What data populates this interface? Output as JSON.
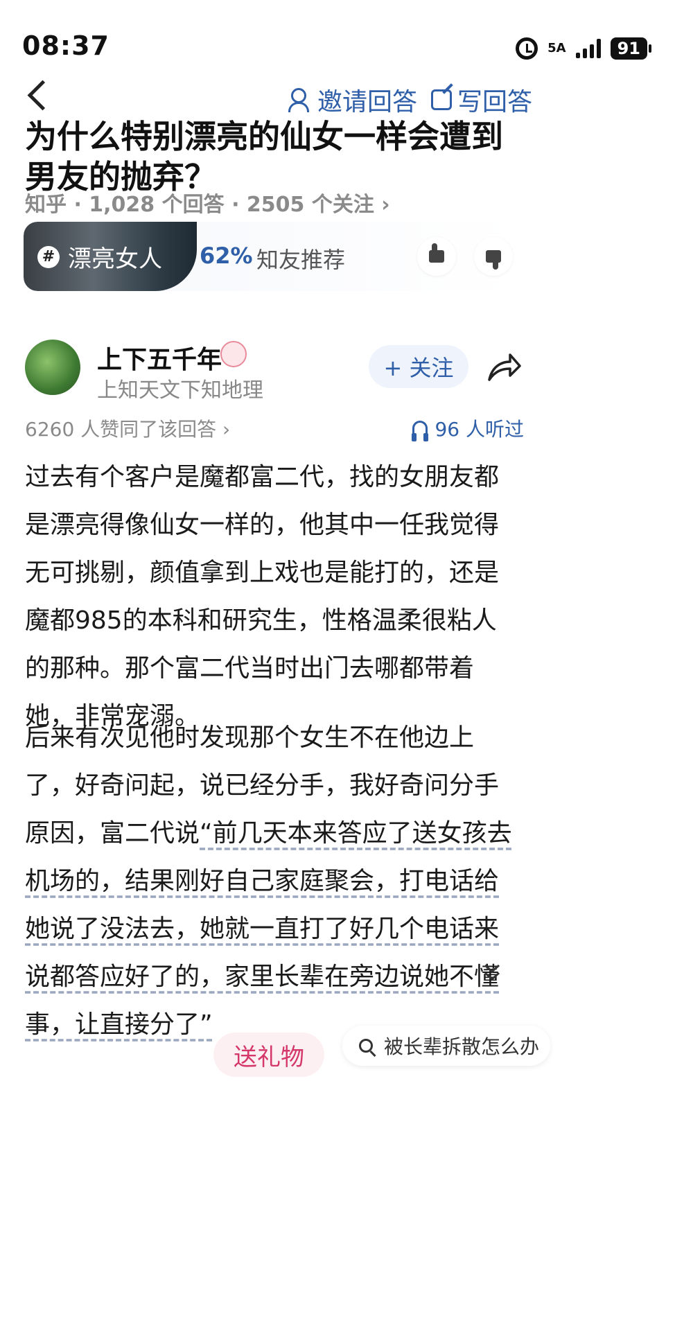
{
  "status_bar": {
    "time": "08:37",
    "network": "5A",
    "battery": "91",
    "icons": [
      "alarm-icon",
      "signal-icon",
      "battery-icon"
    ]
  },
  "header": {
    "invite_label": "邀请回答",
    "write_label": "写回答"
  },
  "question": {
    "title": "为什么特别漂亮的仙女一样会遭到男友的抛弃？",
    "meta": "知乎 · 1,028 个回答 · 2505 个关注 ›"
  },
  "topic": {
    "tag": "漂亮女人",
    "recommend_percent": "62%",
    "recommend_label": "知友推荐"
  },
  "author": {
    "name": "上下五千年",
    "bio": "上知天文下知地理",
    "follow_label": "+ 关注"
  },
  "stats": {
    "agree": "6260 人赞同了该回答 ›",
    "listened": "96 人听过"
  },
  "answer": {
    "para1": "过去有个客户是魔都富二代，找的女朋友都是漂亮得像仙女一样的，他其中一任我觉得无可挑剔，颜值拿到上戏也是能打的，还是魔都985的本科和研究生，性格温柔很粘人的那种。那个富二代当时出门去哪都带着她，非常宠溺。",
    "para2_plain": "后来有次见他时发现那个女生不在他边上了，好奇问起，说已经分手，我好奇问分手原因，富二代说",
    "para2_quote": "“前几天本来答应了送女孩去机场的，结果刚好自己家庭聚会，打电话给她说了没法去，她就一直打了好几个电话来说都答应好了的，家里长辈在旁边说她不懂事，让直接分了”"
  },
  "bottom": {
    "gift_label": "送礼物",
    "search_label": "被长辈拆散怎么办"
  },
  "colors": {
    "accent": "#2f5fa8",
    "gift": "#d4386a"
  }
}
